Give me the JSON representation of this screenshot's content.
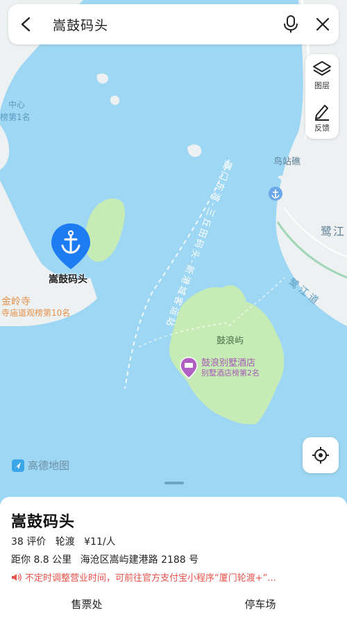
{
  "search": {
    "query": "嵩鼓码头"
  },
  "side_panel": {
    "layers_label": "图层",
    "feedback_label": "反馈"
  },
  "map_labels": {
    "center_partial": "中心",
    "rank_partial": "榜第1名",
    "wuzhanjiao": "鸟站礁",
    "lujiang": "鹭江",
    "lujiang_road": "鹭江道",
    "route": "厦门东渡-三丘田码头-新港城客运站",
    "gulangyu": "鼓浪屿",
    "jinling_temple": "金岭寺",
    "jinling_rank": "寺庙道观榜第10名",
    "hotel_name": "鼓浪别墅酒店",
    "hotel_rank": "别墅酒店榜第2名",
    "pin_label": "嵩鼓码头",
    "logo_text": "高德地图"
  },
  "sheet": {
    "title": "嵩鼓码头",
    "reviews": "38 评价",
    "category": "轮渡",
    "price": "¥11/人",
    "distance": "距你 8.8 公里",
    "address": "海沧区嵩屿建港路 2188 号",
    "notice": "不定时调整营业时间，可前往官方支付宝小程序“厦门轮渡+”...",
    "tab_ticket": "售票处",
    "tab_parking": "停车场"
  },
  "colors": {
    "water": "#9ed7f3",
    "land": "#eef1f2",
    "green": "#c7ebb4",
    "pin": "#1e7cf2",
    "notice": "#e5534b"
  }
}
